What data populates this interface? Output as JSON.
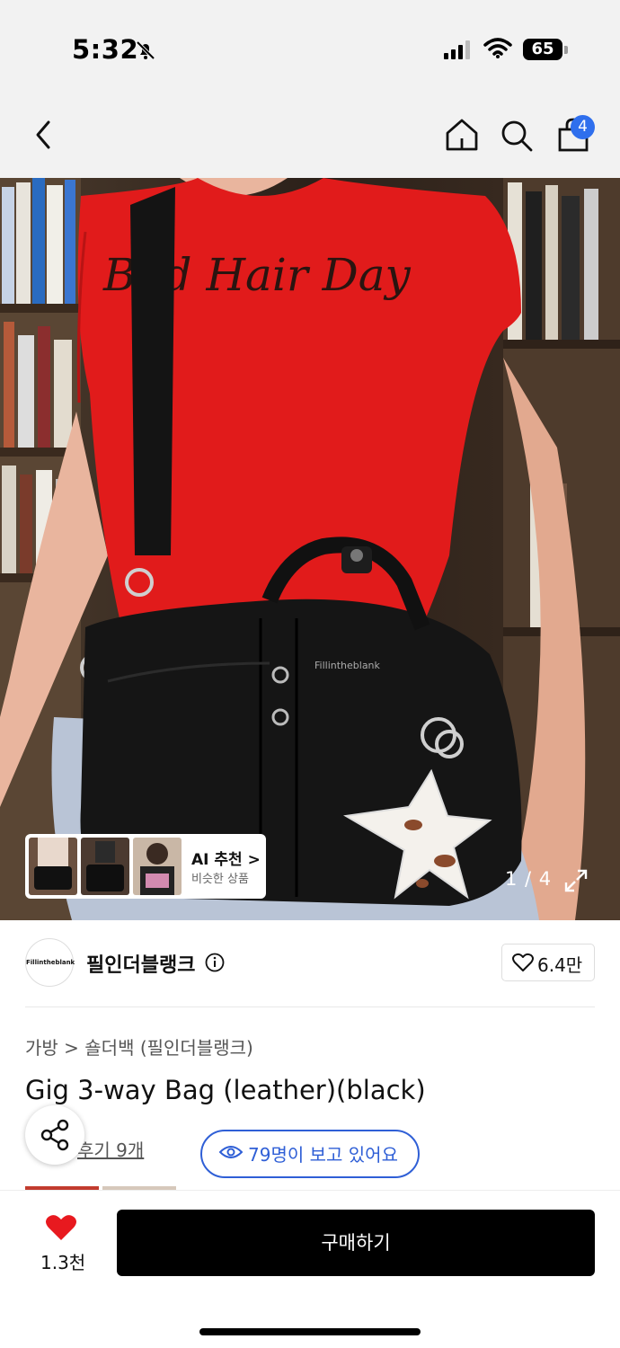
{
  "status_bar": {
    "time": "5:32",
    "battery": "65"
  },
  "header": {
    "cart_count": "4"
  },
  "gallery": {
    "ai_title": "AI 추천 >",
    "ai_subtitle": "비슷한 상품",
    "counter": "1 / 4",
    "shirt_text": "Bad Hair Day",
    "tag_text": "Fillintheblank"
  },
  "brand": {
    "logo_text": "Fillintheblank",
    "name": "필인더블랭크",
    "likes": "6.4만"
  },
  "product": {
    "breadcrumb": "가방 > 숄더백 (필인더블랭크)",
    "title": "Gig 3-way Bag (leather)(black)",
    "reviews": "후기 9개",
    "viewers": "79명이 보고 있어요"
  },
  "bottom": {
    "heart_count": "1.3천",
    "buy_label": "구매하기"
  }
}
